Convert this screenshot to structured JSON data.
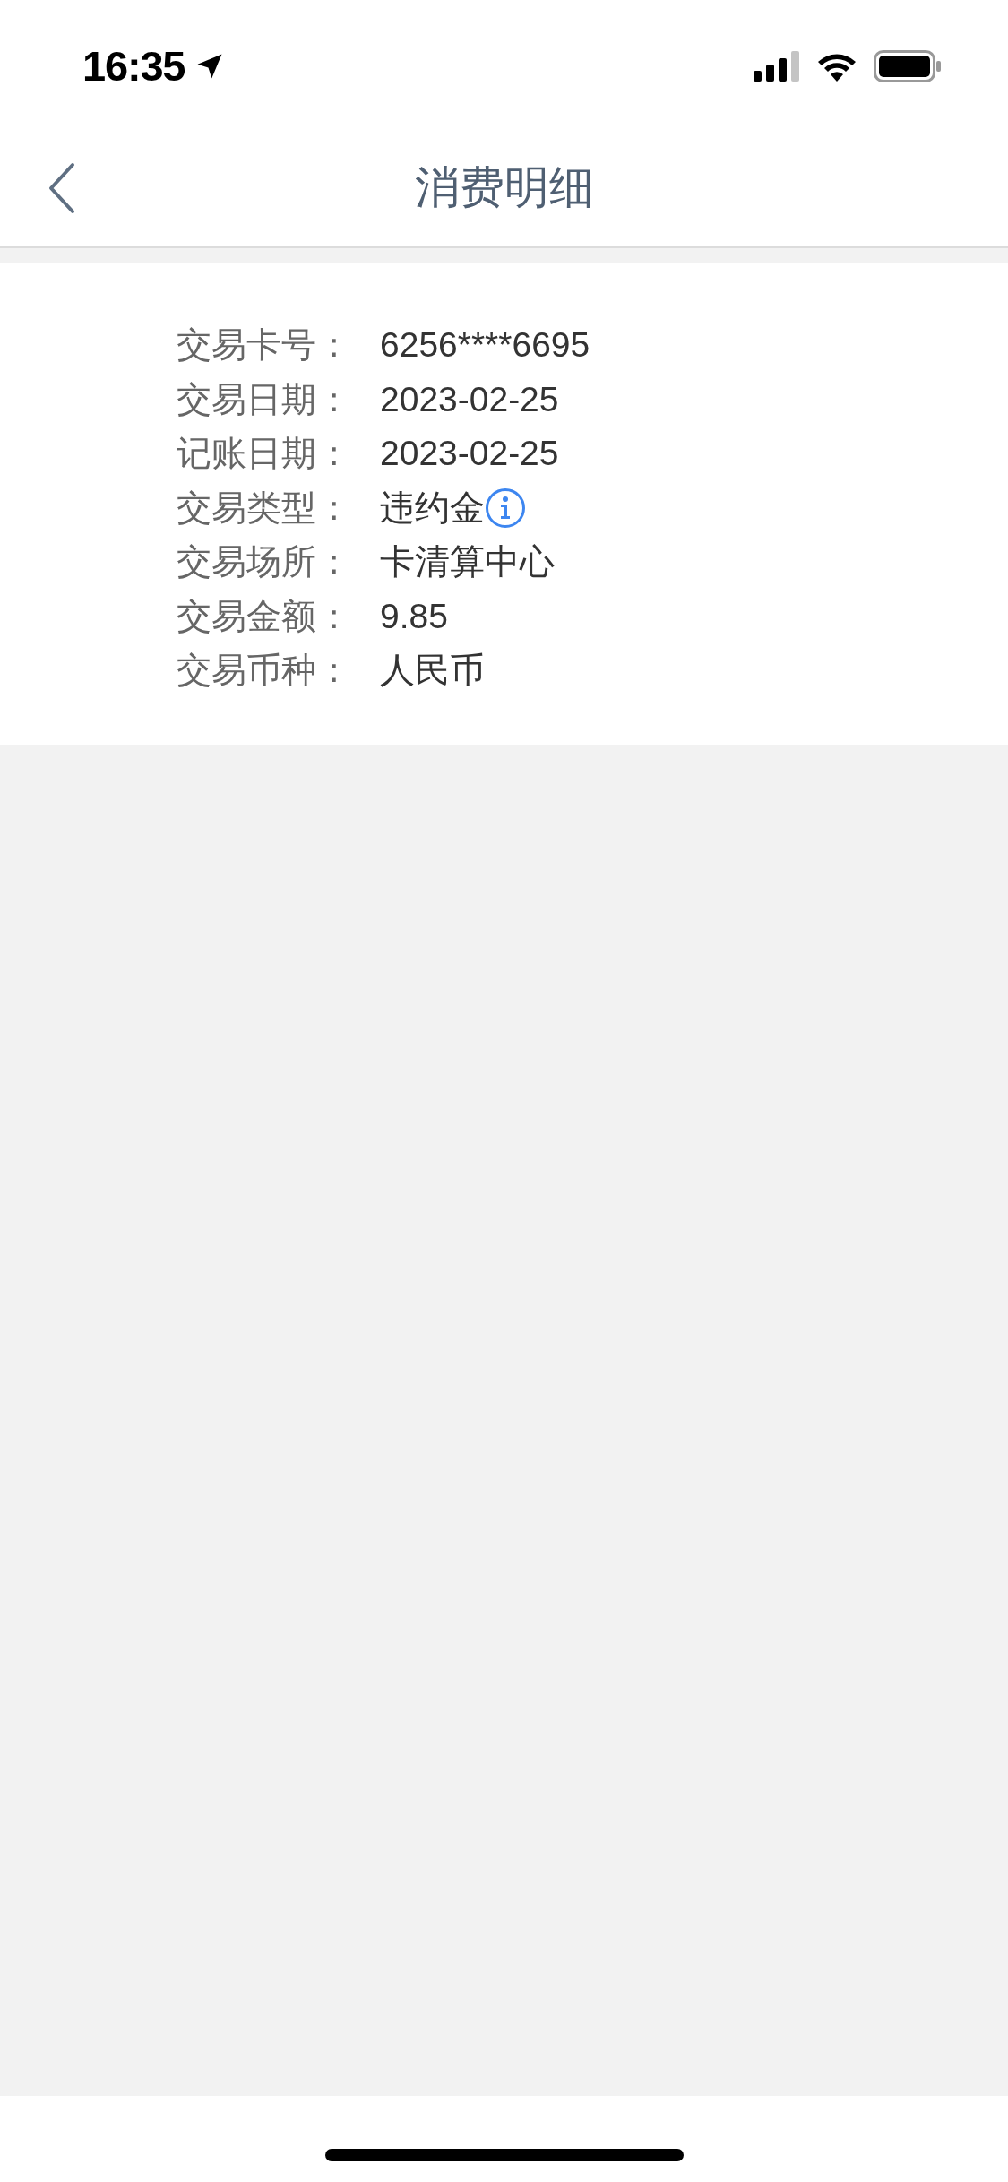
{
  "status_bar": {
    "time": "16:35"
  },
  "nav": {
    "title": "消费明细"
  },
  "details": [
    {
      "label": "交易卡号：",
      "value": "6256****6695",
      "info": false
    },
    {
      "label": "交易日期：",
      "value": "2023-02-25",
      "info": false
    },
    {
      "label": "记账日期：",
      "value": "2023-02-25",
      "info": false
    },
    {
      "label": "交易类型：",
      "value": "违约金",
      "info": true
    },
    {
      "label": "交易场所：",
      "value": "卡清算中心",
      "info": false
    },
    {
      "label": "交易金额：",
      "value": "9.85",
      "info": false
    },
    {
      "label": "交易币种：",
      "value": "人民币",
      "info": false
    }
  ]
}
